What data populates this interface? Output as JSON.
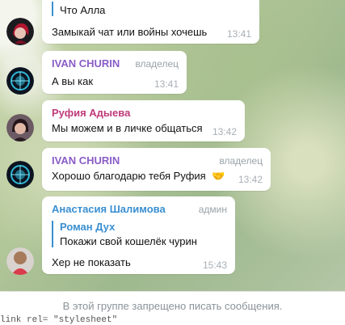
{
  "messages": [
    {
      "reply": {
        "name": "",
        "text": "Что Алла"
      },
      "text": "Замыкай чат или войны хочешь",
      "time": "13:41"
    },
    {
      "sender": "IVAN CHURIN",
      "role": "владелец",
      "text": "А вы как",
      "time": "13:41"
    },
    {
      "sender": "Руфия Адыева",
      "text": "Мы можем и в личке общаться",
      "time": "13:42"
    },
    {
      "sender": "IVAN CHURIN",
      "role": "владелец",
      "text": "Хорошо благодарю тебя Руфия",
      "emoji": "🤝",
      "time": "13:42"
    },
    {
      "sender": "Анастасия Шалимова",
      "role": "админ",
      "reply": {
        "name": "Роман Дух",
        "text": "Покажи свой кошелёк чурин"
      },
      "text": "Хер не показать",
      "time": "15:43"
    }
  ],
  "footer": {
    "notice": "В этой группе запрещено писать сообщения.",
    "code_peek": "link rel= \"stylesheet\""
  },
  "colors": {
    "ivan": "#8a5cc7",
    "rufiya": "#c03a7a",
    "anastasia": "#3a8fd1",
    "reply_bar": "#3a8fd1"
  },
  "icons": {
    "avatars": [
      "avatar-woman-red-hair",
      "avatar-ivan-glow",
      "avatar-rufiya",
      "avatar-ivan-glow",
      "avatar-anastasia"
    ]
  }
}
